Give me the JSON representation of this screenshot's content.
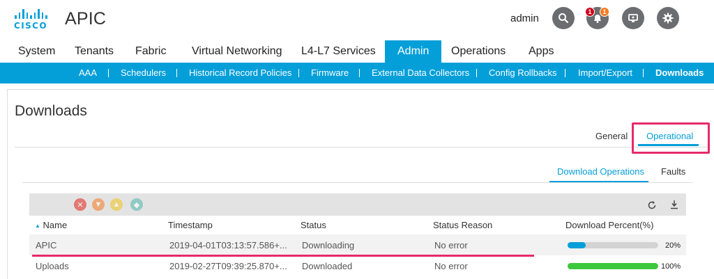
{
  "header": {
    "logo_text": "CISCO",
    "app_title": "APIC",
    "user": "admin",
    "notif_badge_1": "1",
    "notif_badge_2": "1",
    "accent": "#049fd9"
  },
  "nav": {
    "items": [
      "System",
      "Tenants",
      "Fabric",
      "Virtual Networking",
      "L4-L7 Services",
      "Admin",
      "Operations",
      "Apps"
    ],
    "active": "Admin"
  },
  "subnav": {
    "items": [
      "AAA",
      "Schedulers",
      "Historical Record Policies",
      "Firmware",
      "External Data Collectors",
      "Config Rollbacks",
      "Import/Export",
      "Downloads"
    ],
    "active": "Downloads"
  },
  "page": {
    "title": "Downloads",
    "tabs": [
      "General",
      "Operational"
    ],
    "active_tab": "Operational",
    "subtabs": [
      "Download Operations",
      "Faults"
    ],
    "active_subtab": "Download Operations"
  },
  "toolbar": {
    "icons": [
      "critical-icon",
      "major-icon",
      "minor-icon",
      "warning-icon",
      "refresh-icon",
      "download-icon"
    ]
  },
  "table": {
    "columns": [
      "Name",
      "Timestamp",
      "Status",
      "Status Reason",
      "Download Percent(%)"
    ],
    "sort_column": "Name",
    "rows": [
      {
        "name": "APIC",
        "timestamp": "2019-04-01T03:13:57.586+...",
        "status": "Downloading",
        "reason": "No error",
        "percent": 20,
        "percent_label": "20%",
        "bar_color": "#049fd9"
      },
      {
        "name": "Uploads",
        "timestamp": "2019-02-27T09:39:25.870+...",
        "status": "Downloaded",
        "reason": "No error",
        "percent": 100,
        "percent_label": "100%",
        "bar_color": "#3cc83c"
      }
    ]
  },
  "highlight_color": "#e8296b"
}
